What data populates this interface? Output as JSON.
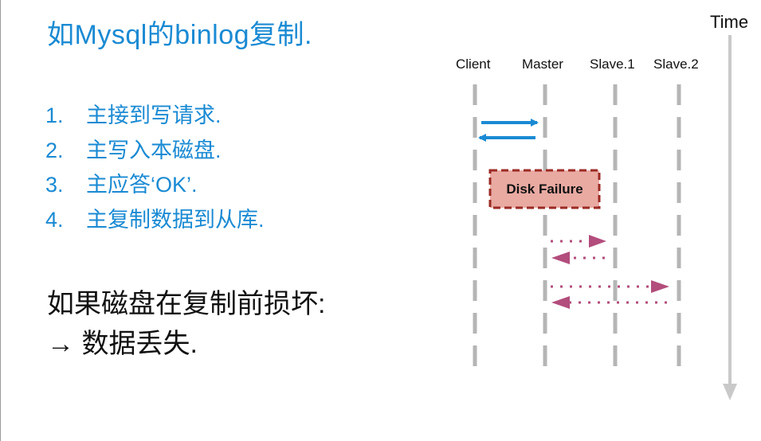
{
  "title": "如Mysql的binlog复制.",
  "steps": [
    {
      "num": "1.",
      "text": "主接到写请求."
    },
    {
      "num": "2.",
      "text": "主写入本磁盘."
    },
    {
      "num": "3.",
      "text": "主应答‘OK’."
    },
    {
      "num": "4.",
      "text": "主复制数据到从库."
    }
  ],
  "warning": {
    "line1": "如果磁盘在复制前损坏:",
    "line2": "→ 数据丢失."
  },
  "diagram": {
    "time_label": "Time",
    "columns": [
      "Client",
      "Master",
      "Slave.1",
      "Slave.2"
    ],
    "failure_label": "Disk Failure",
    "colors": {
      "request_arrow": "#1a8ad3",
      "replication_arrow": "#b24d7c",
      "lifeline": "#b5b5b5",
      "failure_fill": "#e9aaa2",
      "failure_border": "#9b2a24",
      "time_axis": "#c9c9c9"
    }
  }
}
